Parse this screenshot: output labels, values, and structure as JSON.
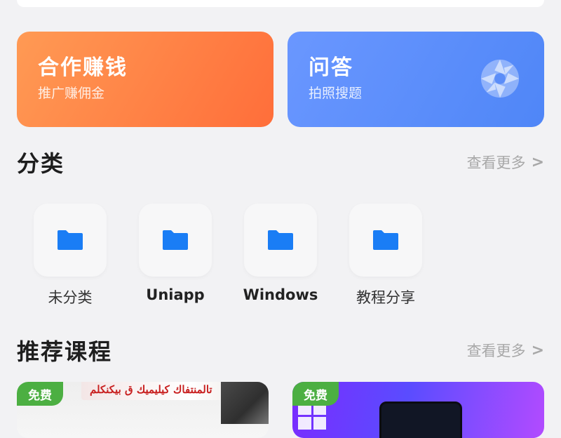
{
  "cards": [
    {
      "title": "合作赚钱",
      "subtitle": "推广赚佣金",
      "color": "#ff7a40"
    },
    {
      "title": "问答",
      "subtitle": "拍照搜题",
      "color": "#5b8df8",
      "icon": "aperture-icon"
    }
  ],
  "categories": {
    "title": "分类",
    "more_label": "查看更多",
    "more_arrow": ">",
    "items": [
      {
        "label": "未分类",
        "icon": "folder-icon"
      },
      {
        "label": "Uniapp",
        "icon": "folder-icon"
      },
      {
        "label": "Windows",
        "icon": "folder-icon"
      },
      {
        "label": "教程分享",
        "icon": "folder-icon"
      }
    ],
    "folder_color": "#1a7df5"
  },
  "recommend": {
    "title": "推荐课程",
    "more_label": "查看更多",
    "more_arrow": ">",
    "courses": [
      {
        "badge": "免费",
        "banner_text": "تالمنتفاك كيليميك ق بيكنكلم"
      },
      {
        "badge": "免费"
      }
    ],
    "badge_color": "#4caf42"
  }
}
